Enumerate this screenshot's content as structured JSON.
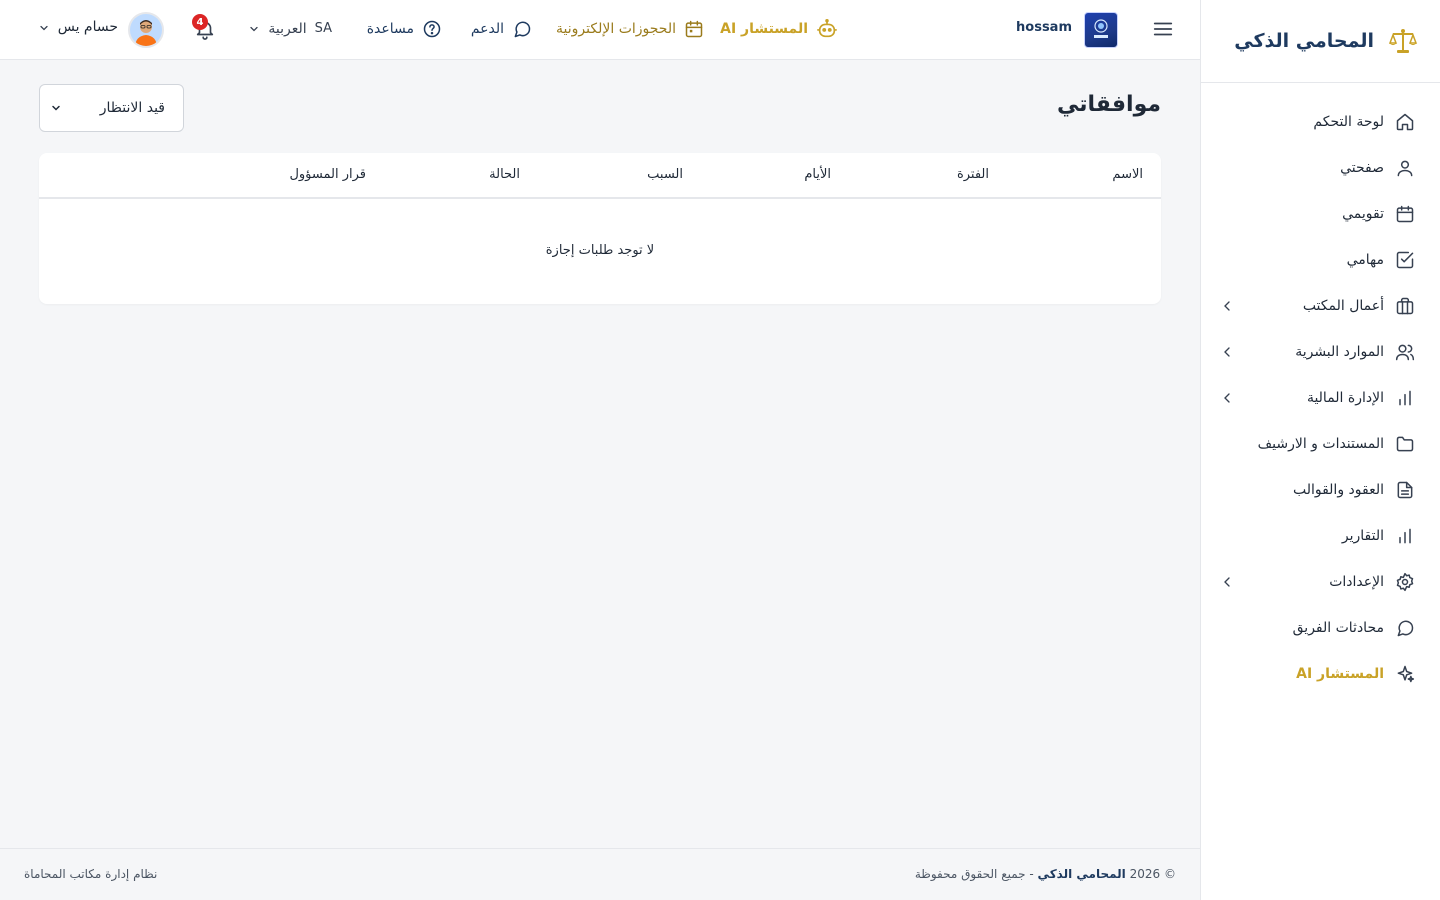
{
  "sidebar": {
    "brand": "المحامي الذكي",
    "items": [
      {
        "label": "لوحة التحكم",
        "icon": "home-icon"
      },
      {
        "label": "صفحتي",
        "icon": "user-icon"
      },
      {
        "label": "تقويمي",
        "icon": "calendar-icon"
      },
      {
        "label": "مهامي",
        "icon": "check-square-icon"
      },
      {
        "label": "أعمال المكتب",
        "icon": "briefcase-icon"
      },
      {
        "label": "الموارد البشرية",
        "icon": "users-icon"
      },
      {
        "label": "الإدارة المالية",
        "icon": "bar-chart-icon"
      },
      {
        "label": "المستندات و الارشيف",
        "icon": "folder-icon"
      },
      {
        "label": "العقود والقوالب",
        "icon": "file-text-icon"
      },
      {
        "label": "التقارير",
        "icon": "bar-chart-icon"
      },
      {
        "label": "الإعدادات",
        "icon": "gear-icon"
      },
      {
        "label": "محادثات الفريق",
        "icon": "chat-icon"
      },
      {
        "label": "المستشار AI",
        "icon": "sparkles-icon"
      }
    ]
  },
  "header": {
    "org_name": "hossam",
    "ai_advisor": "المستشار AI",
    "bookings": "الحجوزات الإلكترونية",
    "support": "الدعم",
    "help": "مساعدة",
    "language": "العربية",
    "language_code": "SA",
    "notifications_count": "4",
    "user_name": "حسام يس"
  },
  "main": {
    "title": "موافقاتي",
    "status_filter": "قيد الانتظار",
    "table": {
      "columns": [
        "الاسم",
        "الفترة",
        "الأيام",
        "السبب",
        "الحالة",
        "قرار المسؤول"
      ],
      "empty_message": "لا توجد طلبات إجازة"
    }
  },
  "footer": {
    "copyright_prefix": "© 2026",
    "brand": "المحامي الذكي",
    "rights": "- جميع الحقوق محفوظة",
    "tagline": "نظام إدارة مكاتب المحاماة"
  },
  "colors": {
    "brand_navy": "#1e3a5f",
    "accent_gold": "#c9a227",
    "badge_red": "#dc2626",
    "background": "#f5f6f8"
  }
}
